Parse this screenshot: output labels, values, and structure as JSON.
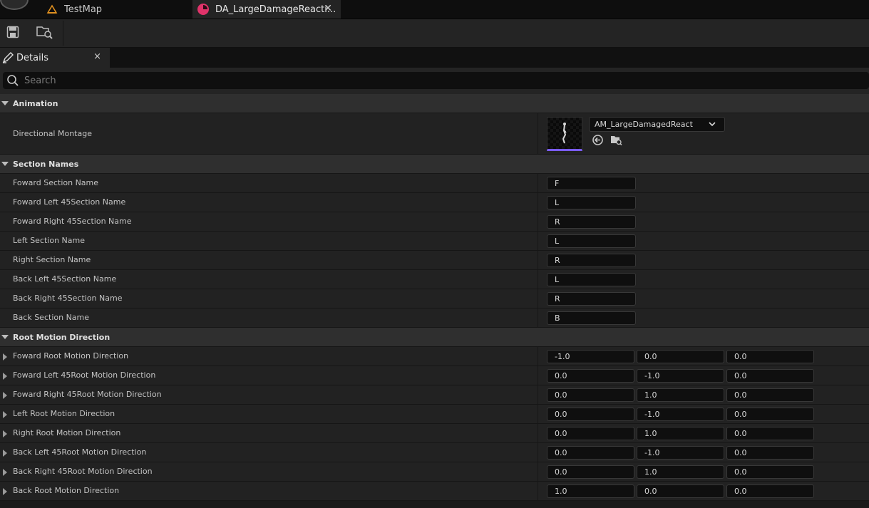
{
  "tabs": [
    {
      "label": "TestMap",
      "icon": "level-icon"
    },
    {
      "label": "DA_LargeDamageReacti...",
      "icon": "data-asset-icon",
      "active": true
    }
  ],
  "toolbar": {
    "buttons": [
      {
        "name": "save-icon"
      },
      {
        "name": "browse-asset-icon"
      }
    ]
  },
  "details": {
    "tab_label": "Details",
    "close": "×"
  },
  "search": {
    "placeholder": "Search"
  },
  "categories": {
    "animation": "Animation",
    "section_names": "Section Names",
    "root_motion_direction": "Root Motion Direction"
  },
  "animation": {
    "directional_montage_label": "Directional Montage",
    "montage_value": "AM_LargeDamagedReact"
  },
  "section_names": [
    {
      "label": "Foward Section Name",
      "value": "F"
    },
    {
      "label": "Foward Left 45Section Name",
      "value": "L"
    },
    {
      "label": "Foward Right 45Section Name",
      "value": "R"
    },
    {
      "label": "Left Section Name",
      "value": "L"
    },
    {
      "label": "Right Section Name",
      "value": "R"
    },
    {
      "label": "Back Left 45Section Name",
      "value": "L"
    },
    {
      "label": "Back Right 45Section Name",
      "value": "R"
    },
    {
      "label": "Back Section Name",
      "value": "B"
    }
  ],
  "root_motion": [
    {
      "label": "Foward Root Motion Direction",
      "x": "-1.0",
      "y": "0.0",
      "z": "0.0"
    },
    {
      "label": "Foward Left 45Root Motion Direction",
      "x": "0.0",
      "y": "-1.0",
      "z": "0.0"
    },
    {
      "label": "Foward Right 45Root Motion Direction",
      "x": "0.0",
      "y": "1.0",
      "z": "0.0"
    },
    {
      "label": "Left Root Motion Direction",
      "x": "0.0",
      "y": "-1.0",
      "z": "0.0"
    },
    {
      "label": "Right Root Motion Direction",
      "x": "0.0",
      "y": "1.0",
      "z": "0.0"
    },
    {
      "label": "Back Left 45Root Motion Direction",
      "x": "0.0",
      "y": "-1.0",
      "z": "0.0"
    },
    {
      "label": "Back Right 45Root Motion Direction",
      "x": "0.0",
      "y": "1.0",
      "z": "0.0"
    },
    {
      "label": "Back Root Motion Direction",
      "x": "1.0",
      "y": "0.0",
      "z": "0.0"
    }
  ],
  "colors": {
    "level_icon": "#e0901f",
    "data_asset_icon": "#e0336a",
    "thumbnail_accent": "#7a5cff"
  }
}
